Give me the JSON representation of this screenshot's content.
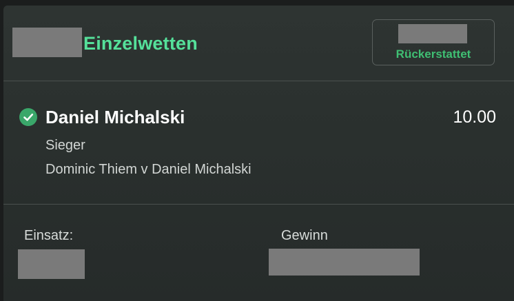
{
  "header": {
    "title": "Einzelwetten",
    "status_label": "Rückerstattet"
  },
  "selection": {
    "name": "Daniel Michalski",
    "odds": "10.00",
    "market": "Sieger",
    "event": "Dominic Thiem v Daniel Michalski",
    "status_icon": "check-circle-icon"
  },
  "footer": {
    "stake_label": "Einsatz:",
    "return_label": "Gewinn"
  },
  "colors": {
    "accent_green": "#55e09a",
    "status_green": "#3fbf73",
    "check_green": "#3aa76a",
    "card_background": "#2c3230"
  }
}
